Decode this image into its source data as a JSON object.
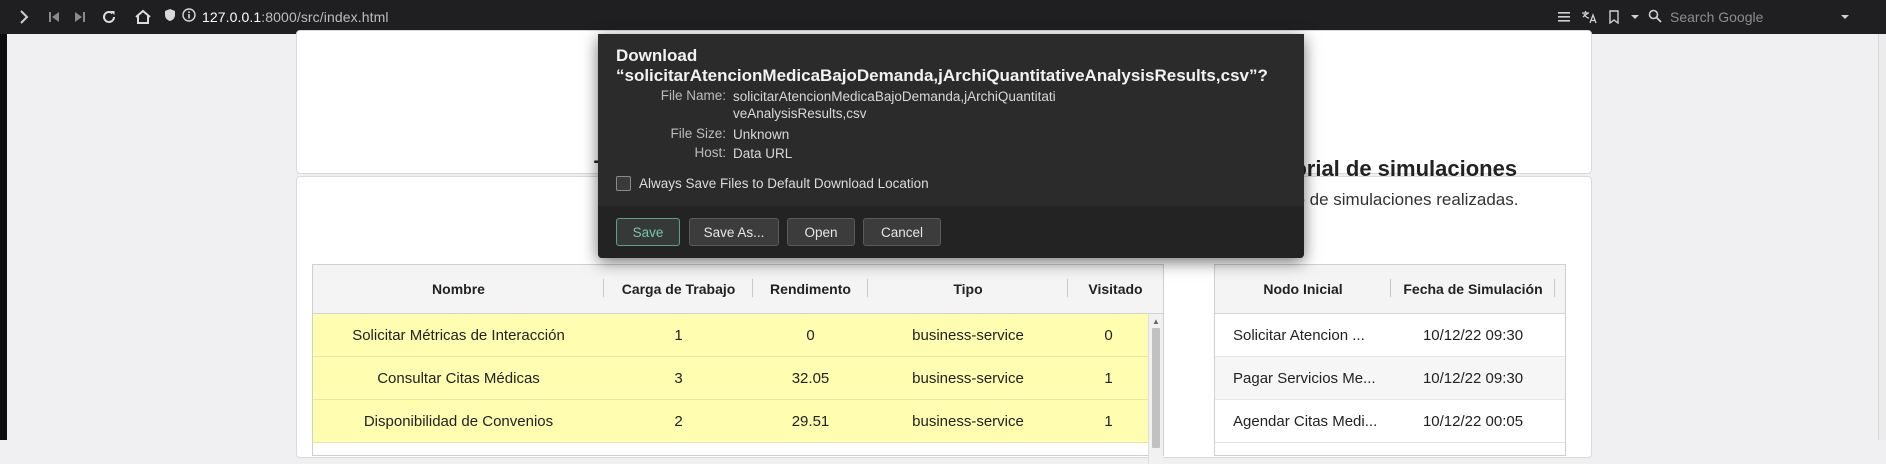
{
  "browser": {
    "url_host": "127.0.0.1",
    "url_rest": ":8000/src/index.html",
    "search_placeholder": "Search Google"
  },
  "page": {
    "left_heading_fragment": "T",
    "sim_title": "torial de simulaciones",
    "sim_subtitle": "do de simulaciones realizadas.",
    "left_table": {
      "columns": [
        "Nombre",
        "Carga de Trabajo",
        "Rendimento",
        "Tipo",
        "Visitado"
      ],
      "rows": [
        [
          "Solicitar Métricas de Interacción",
          "1",
          "0",
          "business-service",
          "0"
        ],
        [
          "Consultar Citas Médicas",
          "3",
          "32.05",
          "business-service",
          "1"
        ],
        [
          "Disponibilidad de Convenios",
          "2",
          "29.51",
          "business-service",
          "1"
        ]
      ]
    },
    "right_table": {
      "columns": [
        "Nodo Inicial",
        "Fecha de Simulación"
      ],
      "rows": [
        [
          "Solicitar Atencion ...",
          "10/12/22 09:30"
        ],
        [
          "Pagar Servicios Me...",
          "10/12/22 09:30"
        ],
        [
          "Agendar Citas Medi...",
          "10/12/22 00:05"
        ]
      ]
    }
  },
  "dialog": {
    "title": "Download “solicitarAtencionMedicaBajoDemanda,jArchiQuantitativeAnalysisResults,csv”?",
    "file_name_label": "File Name:",
    "file_name_line1": "solicitarAtencionMedicaBajoDemanda,jArchiQuantitati",
    "file_name_line2": "veAnalysisResults,csv",
    "file_size_label": "File Size:",
    "file_size_value": "Unknown",
    "host_label": "Host:",
    "host_value": "Data URL",
    "always_save_label": "Always Save Files to Default Download Location",
    "buttons": {
      "save": "Save",
      "save_as": "Save As...",
      "open": "Open",
      "cancel": "Cancel"
    }
  }
}
